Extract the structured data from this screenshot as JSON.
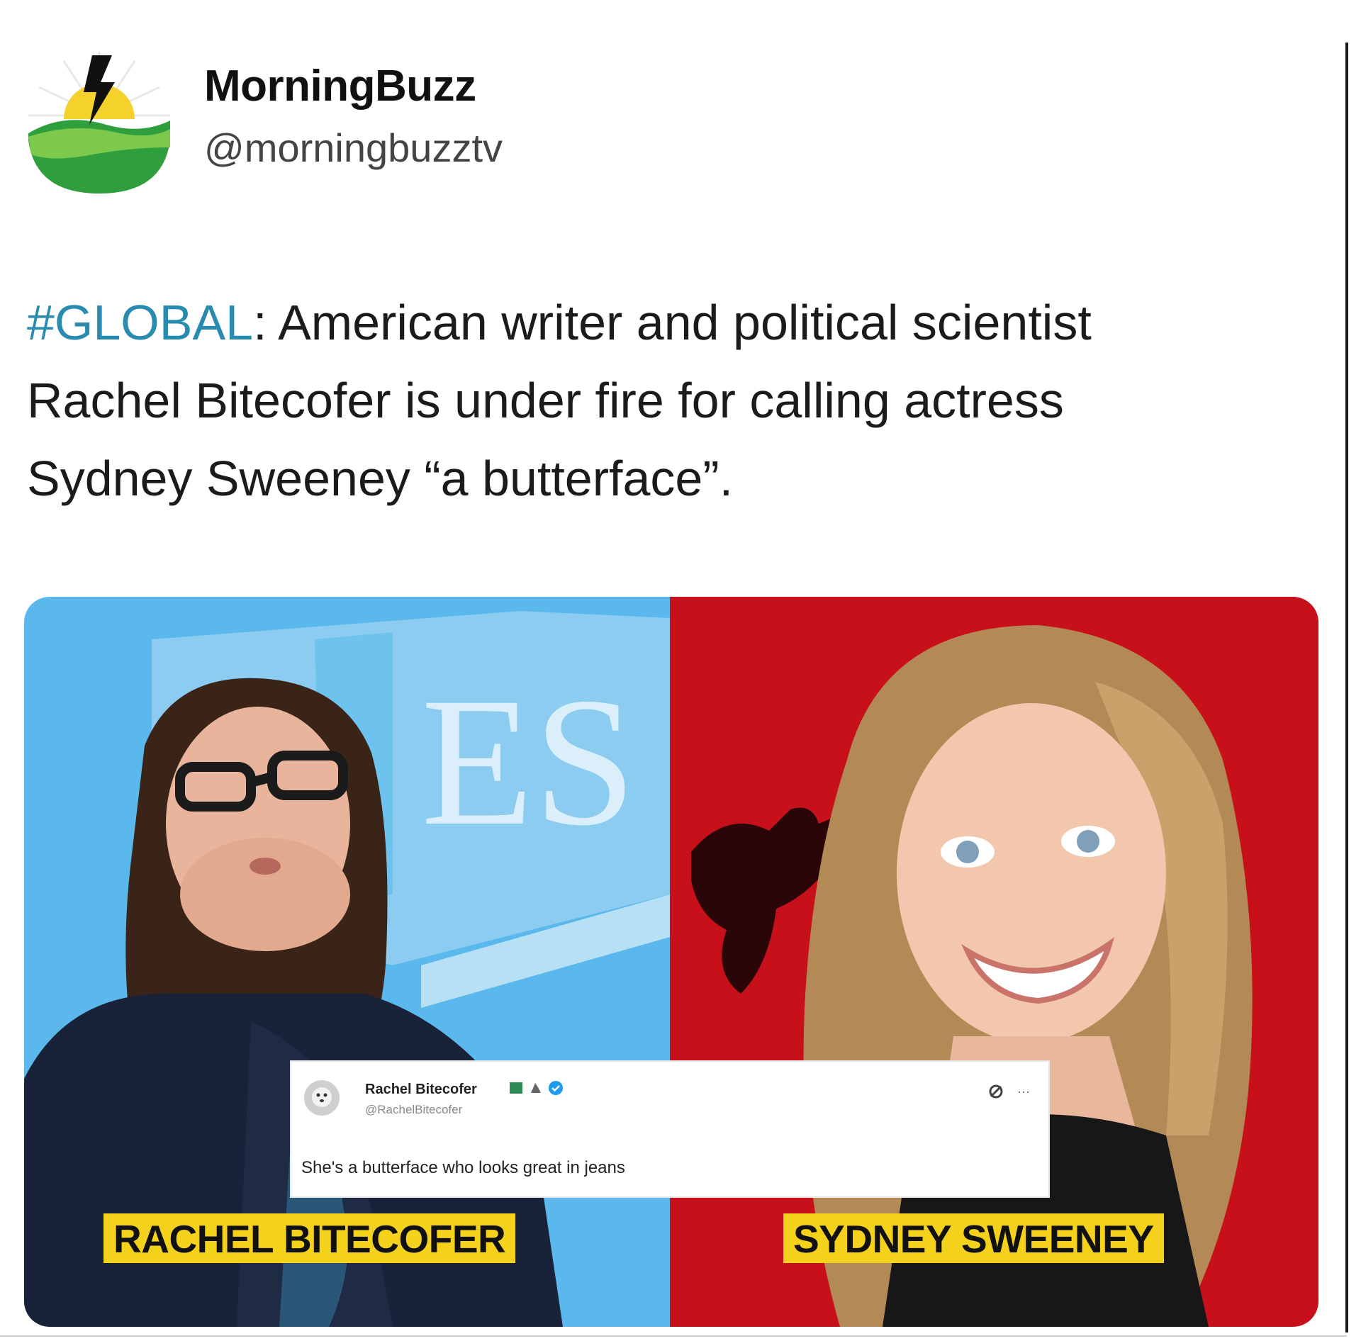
{
  "account": {
    "display_name": "MorningBuzz",
    "handle": "@morningbuzztv",
    "avatar_icon": "morningbuzz-logo"
  },
  "tweet": {
    "hashtag": "#GLOBAL",
    "lines": [
      ": American writer and political scientist",
      "Rachel Bitecofer is under fire for calling actress",
      "Sydney Sweeney “a butterface”."
    ],
    "hashtag_color": "#2a8bb0"
  },
  "media": {
    "left_label": "RACHEL BITECOFER",
    "right_label": "SYDNEY SWEENEY",
    "left_background": "#5ab8ec",
    "right_background": "#c8101a",
    "label_color": "#f4d11a"
  },
  "quoted_tweet": {
    "name": "Rachel Bitecofer",
    "handle": "@RachelBitecofer",
    "text": "She's a butterface who looks great in jeans",
    "more_label": "···"
  }
}
